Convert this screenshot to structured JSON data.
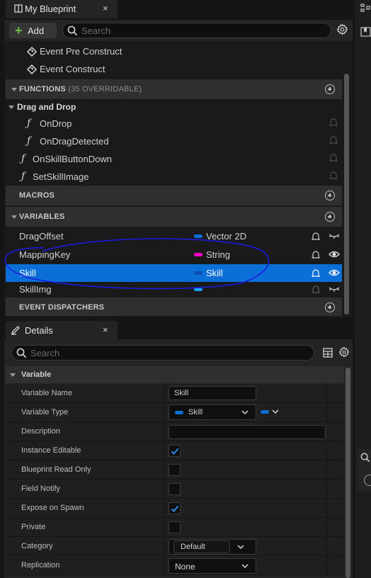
{
  "window": {
    "tab_title": "My Blueprint",
    "close": "×"
  },
  "toolbar": {
    "add_label": "Add",
    "search_placeholder": "Search"
  },
  "events": [
    "Event Pre Construct",
    "Event Construct"
  ],
  "functions": {
    "title": "FUNCTIONS",
    "sub": "(35 OVERRIDABLE)",
    "group": "Drag and Drop",
    "group_items": [
      "OnDrop",
      "OnDragDetected"
    ],
    "items": [
      "OnSkillButtonDown",
      "SetSkillImage"
    ]
  },
  "macros": {
    "title": "MACROS"
  },
  "variables": {
    "title": "VARIABLES",
    "rows": [
      {
        "name": "DragOffset",
        "type": "Vector 2D",
        "color": "#0a70d8",
        "visible": false
      },
      {
        "name": "MappingKey",
        "type": "String",
        "color": "#ff00c8",
        "visible": true
      },
      {
        "name": "Skill",
        "type": "Skill",
        "color": "#0a4fb0",
        "visible": true,
        "selected": true
      },
      {
        "name": "SkillImg",
        "type": "",
        "color": "#1aa0ff",
        "visible": false
      }
    ]
  },
  "dispatchers": {
    "title": "EVENT DISPATCHERS"
  },
  "details": {
    "tab_title": "Details",
    "close": "×",
    "search_placeholder": "Search",
    "section": "Variable",
    "rows": {
      "variable_name": {
        "label": "Variable Name",
        "value": "Skill"
      },
      "variable_type": {
        "label": "Variable Type",
        "value": "Skill"
      },
      "description": {
        "label": "Description",
        "value": ""
      },
      "instance_editable": {
        "label": "Instance Editable",
        "checked": true
      },
      "blueprint_read_only": {
        "label": "Blueprint Read Only",
        "checked": false
      },
      "field_notify": {
        "label": "Field Notify",
        "checked": false
      },
      "expose_on_spawn": {
        "label": "Expose on Spawn",
        "checked": true
      },
      "private": {
        "label": "Private",
        "checked": false
      },
      "category": {
        "label": "Category",
        "value": "Default"
      },
      "replication": {
        "label": "Replication",
        "value": "None"
      }
    }
  },
  "colors": {
    "accent": "#0a70d8",
    "annotation": "#1a1ae0",
    "add_green": "#6cc24a",
    "check_blue": "#2a8cf0"
  }
}
